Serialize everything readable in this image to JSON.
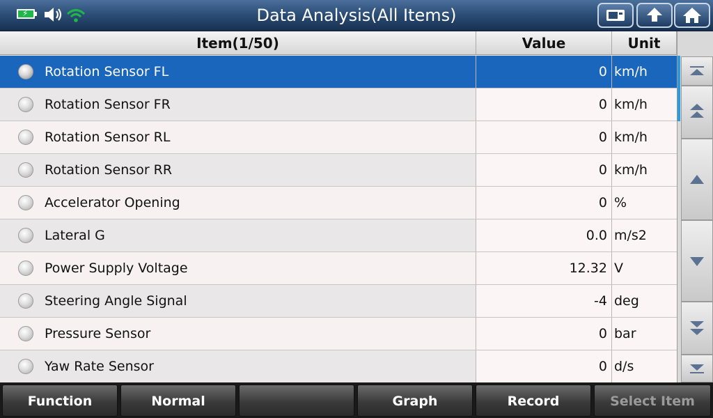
{
  "header": {
    "title": "Data Analysis(All Items)",
    "status_icons": [
      "battery-charging-icon",
      "speaker-icon",
      "wifi-icon"
    ],
    "buttons": [
      "print-screen-icon",
      "back-arrow-icon",
      "home-icon"
    ]
  },
  "table": {
    "columns": [
      "Item(1/50)",
      "Value",
      "Unit"
    ],
    "selected_index": 0,
    "rows": [
      {
        "name": "Rotation Sensor FL",
        "value": "0",
        "unit": "km/h"
      },
      {
        "name": "Rotation Sensor FR",
        "value": "0",
        "unit": "km/h"
      },
      {
        "name": "Rotation Sensor RL",
        "value": "0",
        "unit": "km/h"
      },
      {
        "name": "Rotation Sensor RR",
        "value": "0",
        "unit": "km/h"
      },
      {
        "name": "Accelerator Opening",
        "value": "0",
        "unit": "%"
      },
      {
        "name": "Lateral G",
        "value": "0.0",
        "unit": "m/s2"
      },
      {
        "name": "Power Supply Voltage",
        "value": "12.32",
        "unit": "V"
      },
      {
        "name": "Steering Angle Signal",
        "value": "-4",
        "unit": "deg"
      },
      {
        "name": "Pressure Sensor",
        "value": "0",
        "unit": "bar"
      },
      {
        "name": "Yaw Rate Sensor",
        "value": "0",
        "unit": "d/s"
      }
    ]
  },
  "scroll_buttons": [
    "scroll-top-icon",
    "page-up-icon",
    "line-up-icon",
    "line-down-icon",
    "page-down-icon",
    "scroll-bottom-icon"
  ],
  "footer": {
    "buttons": [
      {
        "label": "Function",
        "enabled": true
      },
      {
        "label": "Normal",
        "enabled": true
      },
      {
        "label": "",
        "enabled": true
      },
      {
        "label": "Graph",
        "enabled": true
      },
      {
        "label": "Record",
        "enabled": true
      },
      {
        "label": "Select Item",
        "enabled": false
      }
    ]
  },
  "colors": {
    "selected_row": "#1764b8",
    "topbar": "#2d4f78",
    "battery": "#1fb64a",
    "wifi": "#1fb64a",
    "scroll_indicator": "#2a9be0"
  }
}
